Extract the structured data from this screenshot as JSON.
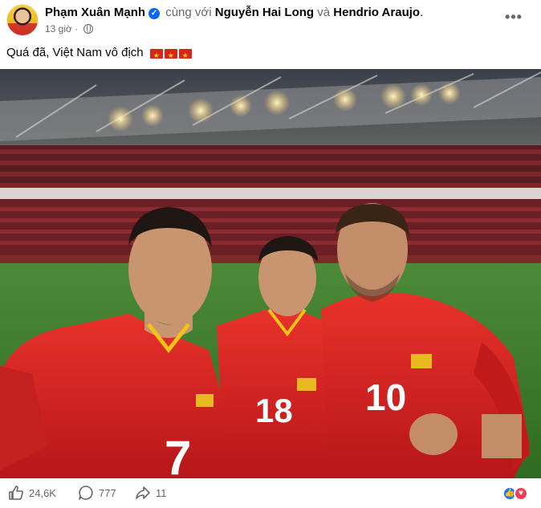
{
  "post": {
    "author": "Phạm Xuân Mạnh",
    "verified": true,
    "with_text": "cùng với",
    "tagged_1": "Nguyễn Hai Long",
    "and_text": "và",
    "tagged_2": "Hendrio Araujo",
    "tagged_suffix": ".",
    "timestamp": "13 giờ",
    "audience_icon": "globe-icon",
    "more_icon": "more-options-icon",
    "more_label": "•••",
    "caption": "Quá đã, Việt Nam vô địch",
    "caption_flags": [
      "vietnam-flag-icon",
      "vietnam-flag-icon",
      "vietnam-flag-icon"
    ]
  },
  "photo": {
    "jersey_numbers": [
      "7",
      "18",
      "10"
    ],
    "colors": {
      "jersey": "#d8231f",
      "pitch": "#3f7f2e",
      "stands": "#5a1d22"
    }
  },
  "footer": {
    "like_count": "24,6K",
    "comment_count": "777",
    "share_count": "11",
    "reactions": [
      "like-reaction-icon",
      "love-reaction-icon"
    ]
  },
  "colors": {
    "text": "#050505",
    "muted": "#65676b",
    "verified_badge": "#0866ff",
    "like_blue": "#1877f2",
    "love_red": "#f33e58"
  }
}
